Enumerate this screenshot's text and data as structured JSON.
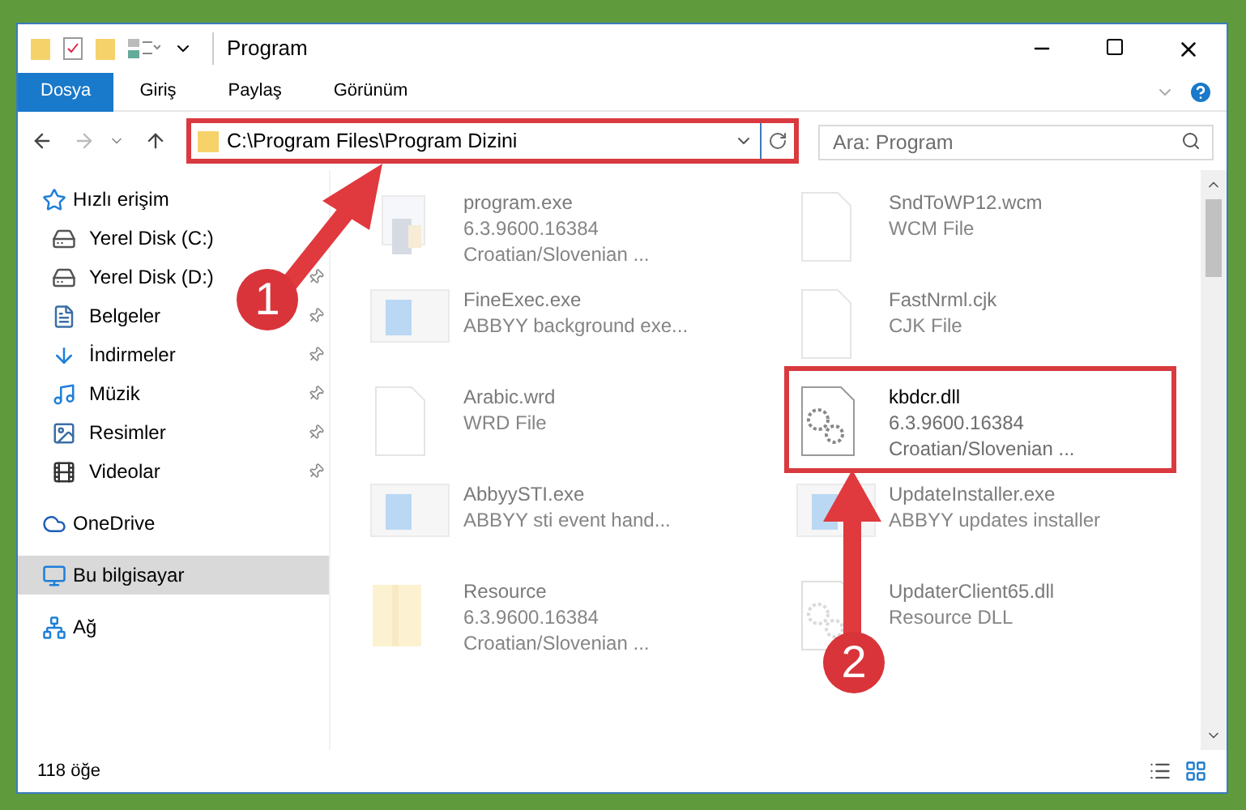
{
  "window": {
    "title": "Program"
  },
  "ribbon_tabs": [
    {
      "label": "Dosya",
      "selected": true
    },
    {
      "label": "Giriş",
      "selected": false
    },
    {
      "label": "Paylaş",
      "selected": false
    },
    {
      "label": "Görünüm",
      "selected": false
    }
  ],
  "address": {
    "path": "C:\\Program Files\\Program Dizini",
    "highlighted": true
  },
  "search": {
    "placeholder": "Ara: Program"
  },
  "sidebar": {
    "items": [
      {
        "label": "Hızlı erişim",
        "kind": "star",
        "selected": false,
        "children": [
          {
            "label": "Yerel Disk (C:)",
            "kind": "drive",
            "pinned": false,
            "selected": false
          },
          {
            "label": "Yerel Disk (D:)",
            "kind": "drive",
            "pinned": true,
            "selected": false
          },
          {
            "label": "Belgeler",
            "kind": "docs",
            "pinned": true,
            "selected": false
          },
          {
            "label": "İndirmeler",
            "kind": "download",
            "pinned": true,
            "selected": false
          },
          {
            "label": "Müzik",
            "kind": "music",
            "pinned": true,
            "selected": false
          },
          {
            "label": "Resimler",
            "kind": "pictures",
            "pinned": true,
            "selected": false
          },
          {
            "label": "Videolar",
            "kind": "video",
            "pinned": true,
            "selected": false
          }
        ]
      },
      {
        "label": "OneDrive",
        "kind": "cloud",
        "selected": false
      },
      {
        "label": "Bu bilgisayar",
        "kind": "pc",
        "selected": true
      },
      {
        "label": "Ağ",
        "kind": "network",
        "selected": false
      }
    ]
  },
  "files": [
    {
      "name": "program.exe",
      "details": [
        "6.3.9600.16384",
        "Croatian/Slovenian ..."
      ],
      "kind": "setup",
      "faded": true,
      "highlighted": false
    },
    {
      "name": "SndToWP12.wcm",
      "details": [
        "WCM File"
      ],
      "kind": "doc",
      "faded": true,
      "highlighted": false
    },
    {
      "name": "FineExec.exe",
      "details": [
        "ABBYY background exe..."
      ],
      "kind": "app",
      "faded": true,
      "highlighted": false
    },
    {
      "name": "FastNrml.cjk",
      "details": [
        "CJK File"
      ],
      "kind": "doc",
      "faded": true,
      "highlighted": false
    },
    {
      "name": "Arabic.wrd",
      "details": [
        "WRD File"
      ],
      "kind": "doc",
      "faded": true,
      "highlighted": false
    },
    {
      "name": "kbdcr.dll",
      "details": [
        "6.3.9600.16384",
        "Croatian/Slovenian ..."
      ],
      "kind": "dll",
      "faded": false,
      "highlighted": true
    },
    {
      "name": "AbbyySTI.exe",
      "details": [
        "ABBYY sti event hand..."
      ],
      "kind": "app",
      "faded": true,
      "highlighted": false
    },
    {
      "name": "UpdateInstaller.exe",
      "details": [
        "ABBYY updates installer"
      ],
      "kind": "app",
      "faded": true,
      "highlighted": false
    },
    {
      "name": "Resource",
      "details": [
        "6.3.9600.16384",
        "Croatian/Slovenian ..."
      ],
      "kind": "folder",
      "faded": true,
      "highlighted": false
    },
    {
      "name": "UpdaterClient65.dll",
      "details": [
        "Resource DLL"
      ],
      "kind": "dll",
      "faded": true,
      "highlighted": false
    }
  ],
  "status_bar": {
    "count": "118 öğe"
  },
  "annotations": [
    {
      "number": "1"
    },
    {
      "number": "2"
    }
  ]
}
